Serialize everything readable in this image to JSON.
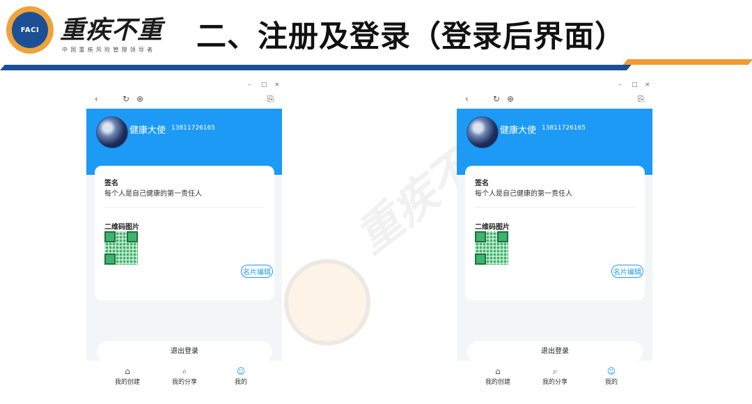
{
  "header": {
    "brand_name": "重疾不重",
    "brand_tagline": "中国重疾风险管理领导者",
    "logo_text": "FACI",
    "slide_title": "二、注册及登录（登录后界面）"
  },
  "watermark": {
    "text": "重疾不重"
  },
  "colors": {
    "accent_blue": "#1c9af6",
    "band_blue": "#1b4f95",
    "band_orange": "#f29a33"
  },
  "window_controls": {
    "minimize": "–",
    "maximize": "□",
    "close": "×"
  },
  "browser_nav": {
    "back_icon": "‹",
    "refresh_icon": "↻",
    "globe_icon": "⊕",
    "share_icon": "⎘"
  },
  "profile": {
    "name": "健康大使",
    "phone": "13811726165",
    "signature_label": "签名",
    "signature_text": "每个人是自己健康的第一责任人",
    "qr_label": "二维码图片",
    "edit_button": "名片编辑",
    "logout_button": "退出登录"
  },
  "bottom_nav": {
    "items": [
      {
        "label": "我的创建",
        "icon": "home-icon",
        "glyph": "⌂"
      },
      {
        "label": "我的分享",
        "icon": "share-search-icon",
        "glyph": "⌕"
      },
      {
        "label": "我的",
        "icon": "user-icon",
        "glyph": "☺"
      }
    ]
  }
}
